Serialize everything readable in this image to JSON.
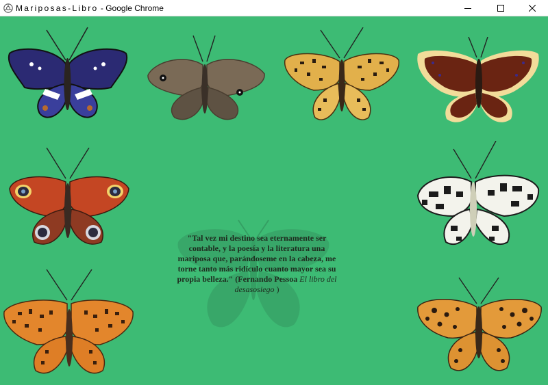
{
  "window": {
    "title_spaced": "Mariposas-Libro",
    "title_sep": " - ",
    "title_app": "Google Chrome"
  },
  "icons": {
    "app": "chrome-app-icon",
    "minimize": "minimize-icon",
    "maximize": "maximize-icon",
    "close": "close-icon"
  },
  "colors": {
    "page_background": "#3dbb74",
    "quote_text": "#1e2a1e"
  },
  "butterflies": [
    {
      "name": "purple-emperor",
      "colors": [
        "#2b2a73",
        "#3a3f9c",
        "#ffffff",
        "#b86a2e"
      ]
    },
    {
      "name": "meadow-brown",
      "colors": [
        "#7a6a56",
        "#5e5243",
        "#111111"
      ]
    },
    {
      "name": "fritillary-yellow",
      "colors": [
        "#e2b04b",
        "#2a1c10"
      ]
    },
    {
      "name": "camberwell-beauty",
      "colors": [
        "#6a2412",
        "#f2dc9a",
        "#3c2a8a"
      ]
    },
    {
      "name": "peacock",
      "colors": [
        "#c44623",
        "#2c2a3e",
        "#f2d36b"
      ]
    },
    {
      "name": "marbled-white",
      "colors": [
        "#f3f3ec",
        "#1b1b1b"
      ]
    },
    {
      "name": "silver-washed-fritillary",
      "colors": [
        "#e3862c",
        "#3a1f0d"
      ]
    },
    {
      "name": "queen-of-spain-fritillary",
      "colors": [
        "#e39a3a",
        "#2a1a0f"
      ]
    }
  ],
  "quote": {
    "text": "\"Tal vez mi destino sea eternamente ser contable, y la poesía y la literatura una mariposa que, parándoseme en la cabeza, me torne tanto más ridículo cuanto mayor sea su propia belleza.\" (Fernando Pessoa",
    "book": "El libro del desasosiego",
    "end": " )"
  }
}
